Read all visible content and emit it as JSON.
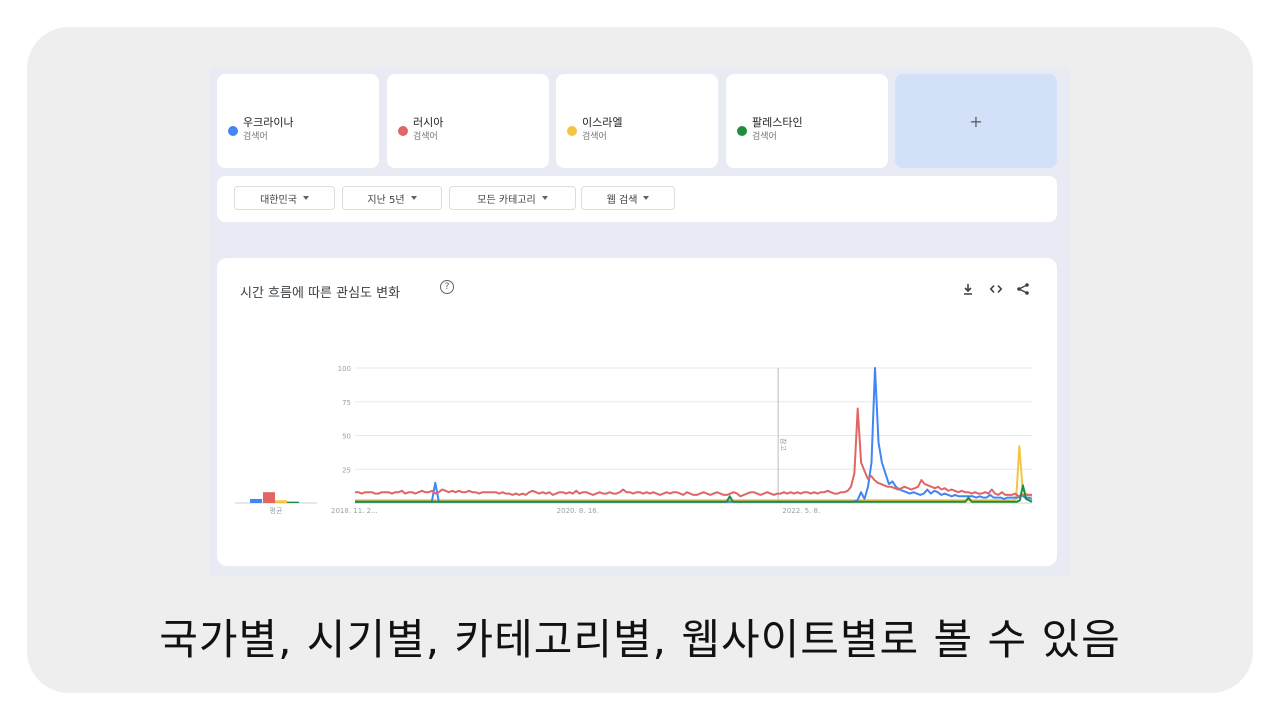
{
  "search_terms": [
    {
      "name": "우크라이나",
      "type": "검색어",
      "color": "#4285f4"
    },
    {
      "name": "러시아",
      "type": "검색어",
      "color": "#e06666"
    },
    {
      "name": "이스라엘",
      "type": "검색어",
      "color": "#f4c542"
    },
    {
      "name": "팔레스타인",
      "type": "검색어",
      "color": "#1e8e3e"
    }
  ],
  "add_term_label": "+",
  "filters": {
    "region": "대한민국",
    "period": "지난 5년",
    "category": "모든 카테고리",
    "search_type": "웹 검색"
  },
  "chart_header": {
    "title": "시간 흐름에 따른 관심도 변화",
    "help": "?"
  },
  "average_label": "평균",
  "note_label": "참고",
  "chart_data": {
    "type": "line",
    "ylim": [
      0,
      100
    ],
    "yticks": [
      "100",
      "75",
      "50",
      "25"
    ],
    "x_tick_labels": [
      "2018. 11. 2...",
      "2020. 8. 16.",
      "2022. 5. 8."
    ],
    "average_values": [
      3,
      8,
      2,
      1
    ],
    "series": [
      {
        "name": "우크라이나",
        "color": "#4285f4",
        "values": [
          1,
          1,
          1,
          1,
          1,
          1,
          1,
          1,
          1,
          1,
          1,
          1,
          1,
          1,
          1,
          1,
          1,
          1,
          1,
          1,
          1,
          1,
          1,
          15,
          1,
          1,
          1,
          1,
          1,
          1,
          1,
          1,
          1,
          1,
          1,
          1,
          1,
          1,
          1,
          1,
          1,
          1,
          1,
          1,
          1,
          1,
          1,
          1,
          1,
          1,
          1,
          1,
          1,
          1,
          1,
          1,
          1,
          1,
          1,
          1,
          1,
          1,
          1,
          1,
          1,
          1,
          1,
          1,
          1,
          1,
          1,
          1,
          1,
          1,
          1,
          1,
          1,
          1,
          1,
          1,
          1,
          1,
          1,
          1,
          1,
          1,
          1,
          1,
          1,
          1,
          1,
          1,
          1,
          1,
          1,
          1,
          1,
          1,
          1,
          1,
          1,
          1,
          1,
          1,
          1,
          1,
          1,
          1,
          1,
          1,
          1,
          1,
          1,
          1,
          1,
          1,
          1,
          1,
          1,
          1,
          1,
          1,
          1,
          1,
          1,
          1,
          1,
          1,
          1,
          1,
          1,
          1,
          1,
          1,
          1,
          1,
          1,
          1,
          1,
          1,
          1,
          1,
          1,
          1,
          2,
          8,
          3,
          12,
          30,
          100,
          45,
          30,
          22,
          14,
          16,
          12,
          10,
          9,
          8,
          7,
          8,
          7,
          6,
          7,
          10,
          7,
          9,
          8,
          6,
          7,
          6,
          5,
          6,
          5,
          5,
          5,
          5,
          5,
          4,
          5,
          4,
          4,
          6,
          4,
          4,
          4,
          3,
          4,
          4,
          4,
          4,
          6,
          4,
          4,
          3
        ]
      },
      {
        "name": "러시아",
        "color": "#e06666",
        "values": [
          8,
          8,
          7,
          8,
          8,
          8,
          7,
          7,
          8,
          8,
          8,
          7,
          8,
          8,
          9,
          7,
          8,
          8,
          7,
          8,
          9,
          8,
          8,
          9,
          7,
          8,
          10,
          9,
          8,
          9,
          8,
          9,
          8,
          8,
          9,
          8,
          8,
          7,
          8,
          8,
          8,
          8,
          8,
          7,
          8,
          7,
          7,
          6,
          7,
          6,
          7,
          6,
          8,
          9,
          8,
          7,
          8,
          7,
          8,
          6,
          7,
          8,
          8,
          7,
          8,
          7,
          9,
          7,
          8,
          8,
          7,
          6,
          7,
          8,
          7,
          7,
          8,
          7,
          7,
          8,
          10,
          8,
          8,
          7,
          8,
          8,
          7,
          8,
          7,
          8,
          7,
          6,
          7,
          8,
          7,
          8,
          8,
          7,
          6,
          8,
          7,
          6,
          6,
          7,
          8,
          7,
          6,
          7,
          8,
          7,
          6,
          6,
          7,
          8,
          7,
          5,
          6,
          7,
          8,
          8,
          7,
          6,
          7,
          8,
          7,
          6,
          7,
          7,
          8,
          7,
          8,
          7,
          8,
          7,
          8,
          8,
          7,
          8,
          7,
          8,
          8,
          9,
          8,
          7,
          7,
          8,
          8,
          9,
          12,
          22,
          70,
          30,
          24,
          18,
          20,
          17,
          15,
          14,
          13,
          12,
          12,
          11,
          10,
          11,
          12,
          11,
          10,
          11,
          12,
          17,
          14,
          13,
          12,
          11,
          12,
          10,
          11,
          9,
          10,
          9,
          8,
          9,
          8,
          8,
          7,
          8,
          7,
          7,
          8,
          7,
          10,
          7,
          6,
          8,
          6,
          6,
          6,
          7,
          5,
          6,
          6,
          6,
          6
        ]
      },
      {
        "name": "이스라엘",
        "color": "#f4c542",
        "values": [
          2,
          2,
          2,
          2,
          2,
          2,
          2,
          2,
          2,
          2,
          2,
          2,
          2,
          2,
          2,
          2,
          2,
          2,
          2,
          2,
          2,
          2,
          2,
          2,
          2,
          2,
          2,
          2,
          2,
          2,
          2,
          2,
          2,
          2,
          2,
          2,
          2,
          2,
          2,
          2,
          2,
          2,
          2,
          2,
          2,
          2,
          2,
          2,
          2,
          2,
          2,
          2,
          2,
          2,
          2,
          2,
          2,
          2,
          2,
          2,
          2,
          2,
          2,
          2,
          2,
          2,
          2,
          2,
          2,
          2,
          2,
          2,
          2,
          2,
          2,
          2,
          2,
          2,
          2,
          2,
          2,
          2,
          2,
          2,
          2,
          2,
          2,
          2,
          2,
          2,
          2,
          2,
          2,
          2,
          2,
          2,
          2,
          2,
          2,
          2,
          2,
          2,
          2,
          2,
          2,
          2,
          2,
          2,
          2,
          2,
          2,
          2,
          2,
          2,
          2,
          2,
          2,
          2,
          2,
          2,
          2,
          2,
          2,
          2,
          2,
          2,
          2,
          2,
          2,
          2,
          2,
          2,
          2,
          2,
          2,
          2,
          2,
          2,
          2,
          2,
          2,
          2,
          2,
          2,
          2,
          2,
          2,
          2,
          2,
          2,
          2,
          2,
          2,
          2,
          2,
          2,
          2,
          2,
          2,
          2,
          2,
          2,
          2,
          2,
          2,
          2,
          2,
          2,
          2,
          2,
          2,
          2,
          2,
          2,
          2,
          2,
          2,
          2,
          2,
          2,
          2,
          2,
          2,
          2,
          2,
          2,
          2,
          2,
          2,
          2,
          2,
          2,
          2,
          2,
          2,
          2,
          2,
          2,
          2,
          2,
          2,
          2,
          2,
          2,
          2,
          2,
          2,
          2,
          2,
          3,
          42,
          12,
          7,
          6,
          5
        ]
      },
      {
        "name": "팔레스타인",
        "color": "#1e8e3e",
        "values": [
          1,
          1,
          1,
          1,
          1,
          1,
          1,
          1,
          1,
          1,
          1,
          1,
          1,
          1,
          1,
          1,
          1,
          1,
          1,
          1,
          1,
          1,
          1,
          1,
          1,
          1,
          1,
          1,
          1,
          1,
          1,
          1,
          1,
          1,
          1,
          1,
          1,
          1,
          1,
          1,
          1,
          1,
          1,
          1,
          1,
          1,
          1,
          1,
          1,
          1,
          1,
          1,
          1,
          1,
          1,
          1,
          1,
          1,
          1,
          1,
          1,
          1,
          1,
          1,
          1,
          1,
          1,
          1,
          1,
          1,
          1,
          1,
          1,
          1,
          1,
          1,
          1,
          1,
          1,
          1,
          1,
          1,
          1,
          1,
          1,
          1,
          1,
          1,
          1,
          1,
          1,
          1,
          1,
          1,
          1,
          1,
          1,
          1,
          1,
          1,
          1,
          1,
          1,
          1,
          1,
          1,
          1,
          1,
          1,
          1,
          1,
          1,
          1,
          1,
          1,
          1,
          1,
          1,
          1,
          1,
          1,
          1,
          1,
          1,
          5,
          1,
          1,
          1,
          1,
          1,
          1,
          1,
          1,
          1,
          1,
          1,
          1,
          1,
          1,
          1,
          1,
          1,
          1,
          1,
          1,
          1,
          1,
          1,
          1,
          1,
          1,
          1,
          1,
          1,
          1,
          1,
          1,
          1,
          1,
          1,
          1,
          1,
          1,
          1,
          1,
          1,
          1,
          1,
          1,
          1,
          1,
          1,
          1,
          1,
          1,
          1,
          1,
          1,
          1,
          1,
          1,
          1,
          1,
          1,
          1,
          1,
          1,
          1,
          1,
          1,
          1,
          1,
          1,
          1,
          1,
          1,
          1,
          1,
          1,
          1,
          1,
          1,
          1,
          4,
          1,
          1,
          1,
          1,
          1,
          1,
          1,
          1,
          1,
          1,
          1,
          1,
          1,
          1,
          1,
          1,
          2,
          13,
          3,
          2,
          1
        ]
      }
    ]
  },
  "caption": "국가별, 시기별, 카테고리별, 웹사이트별로 볼 수 있음"
}
